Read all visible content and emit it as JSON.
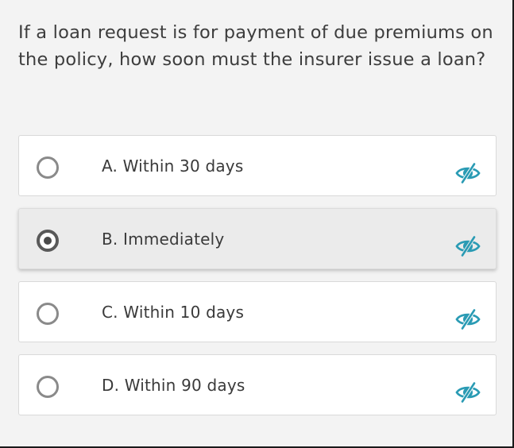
{
  "question": {
    "text": "If a loan request is for payment of due premiums on the policy, how soon must the insurer issue a loan?"
  },
  "options": [
    {
      "label": "A. Within 30 days",
      "selected": false,
      "icon": "eye-slash-icon"
    },
    {
      "label": "B. Immediately",
      "selected": true,
      "icon": "eye-slash-icon"
    },
    {
      "label": "C. Within 10 days",
      "selected": false,
      "icon": "eye-slash-icon"
    },
    {
      "label": "D. Within 90 days",
      "selected": false,
      "icon": "eye-slash-icon"
    }
  ],
  "colors": {
    "accent_icon": "#2a9bb4",
    "background": "#f3f3f3",
    "selected_background": "#ebebeb"
  }
}
